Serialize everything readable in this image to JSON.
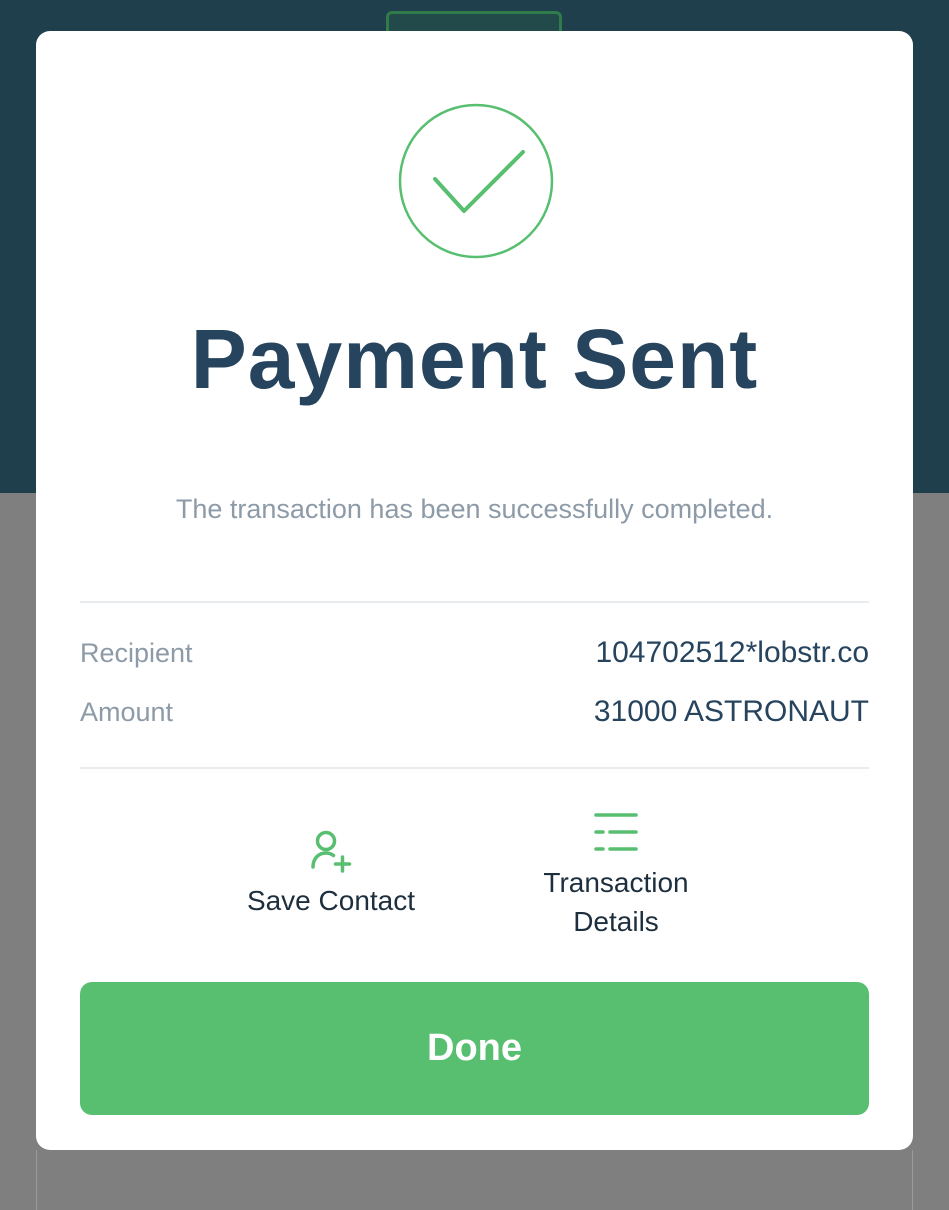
{
  "modal": {
    "title": "Payment Sent",
    "subtitle": "The transaction has been successfully completed.",
    "success_icon": "checkmark-circle-icon",
    "details": [
      {
        "label": "Recipient",
        "value": "104702512*lobstr.co"
      },
      {
        "label": "Amount",
        "value": "31000 ASTRONAUT"
      }
    ],
    "actions": {
      "save_contact": {
        "label": "Save Contact",
        "icon": "add-contact-icon"
      },
      "transaction_details": {
        "label_line1": "Transaction",
        "label_line2": "Details",
        "icon": "list-icon"
      }
    },
    "done_label": "Done"
  },
  "colors": {
    "accent_green": "#58bf70",
    "title_navy": "#27445e",
    "muted_gray": "#8d9aa7",
    "header_teal": "#1f3f4c",
    "overlay_gray": "#7f7f7f"
  }
}
